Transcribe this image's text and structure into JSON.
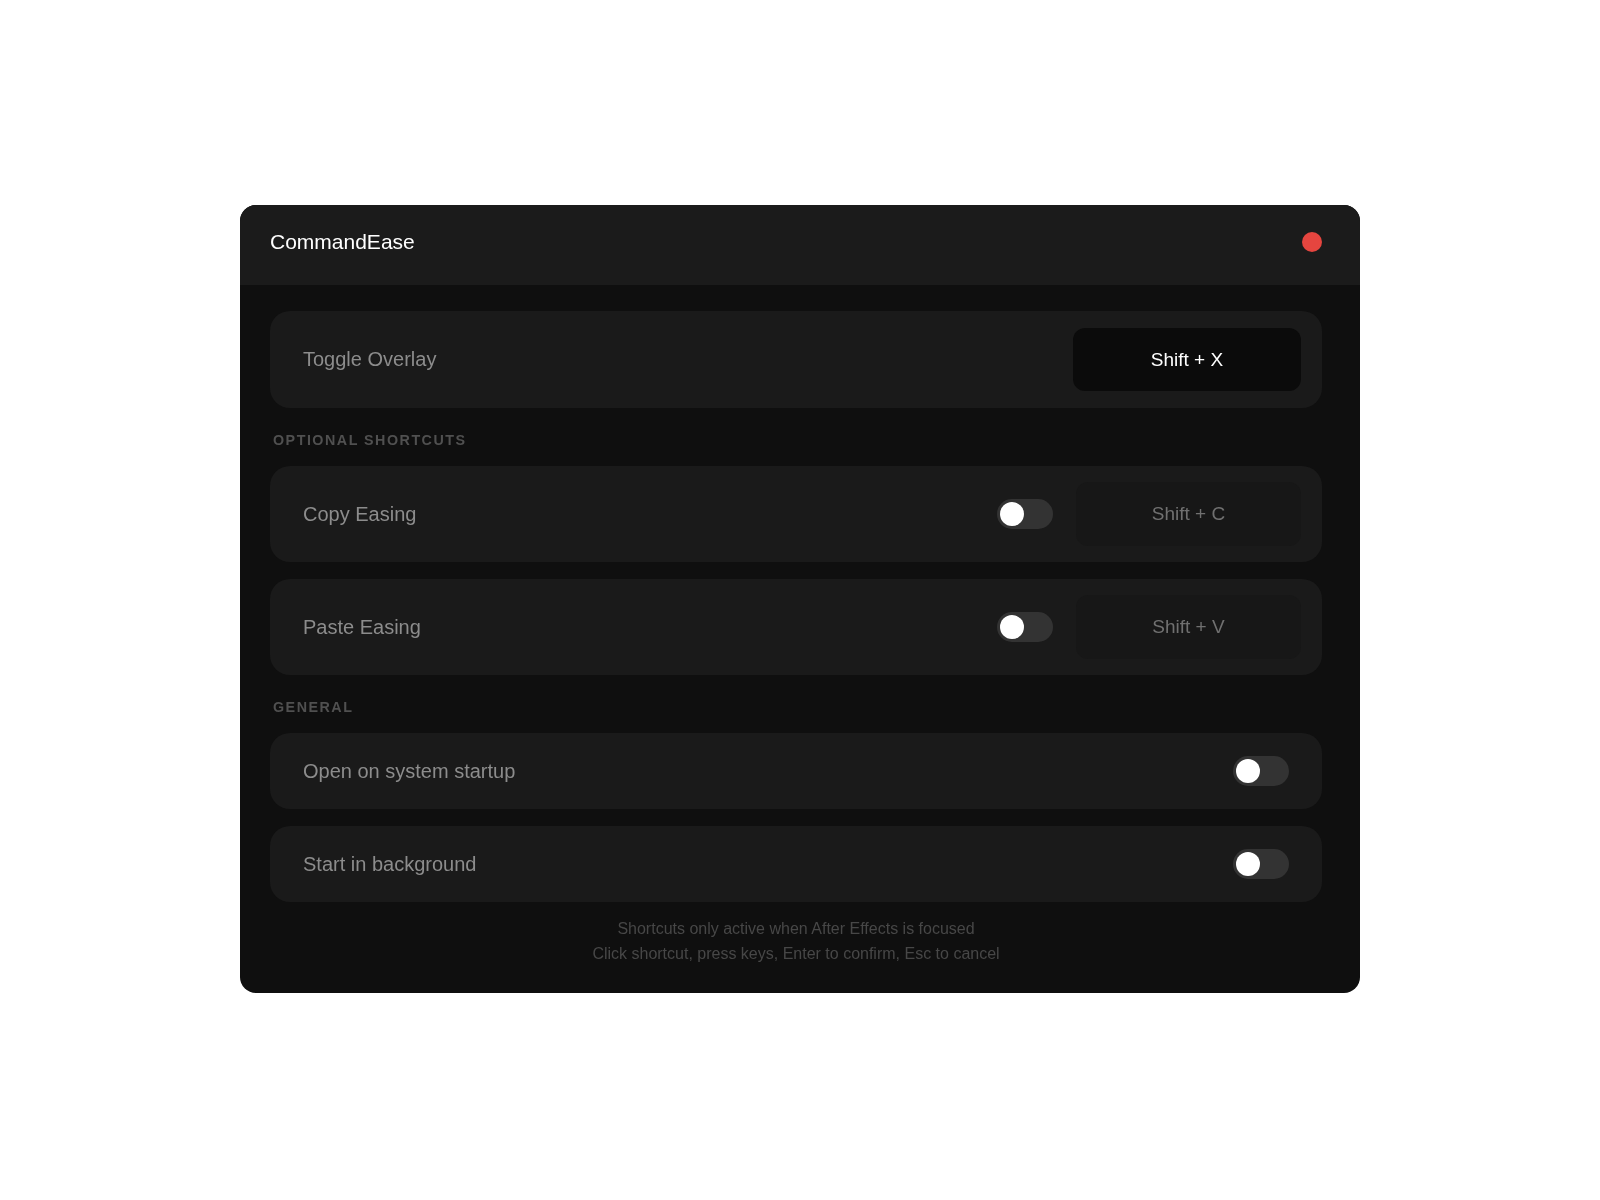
{
  "window": {
    "title": "CommandEase"
  },
  "primary": {
    "label": "Toggle Overlay",
    "shortcut": "Shift + X"
  },
  "sections": [
    {
      "heading": "OPTIONAL SHORTCUTS",
      "items": [
        {
          "kind": "shortcut",
          "label": "Copy Easing",
          "on": false,
          "shortcut": "Shift + C"
        },
        {
          "kind": "shortcut",
          "label": "Paste Easing",
          "on": false,
          "shortcut": "Shift + V"
        }
      ]
    },
    {
      "heading": "GENERAL",
      "items": [
        {
          "kind": "toggle",
          "label": "Open on system startup",
          "on": false
        },
        {
          "kind": "toggle",
          "label": "Start in background",
          "on": false
        }
      ]
    }
  ],
  "footer": [
    "Shortcuts only active when After Effects is focused",
    "Click shortcut, press keys, Enter to confirm, Esc to cancel"
  ]
}
